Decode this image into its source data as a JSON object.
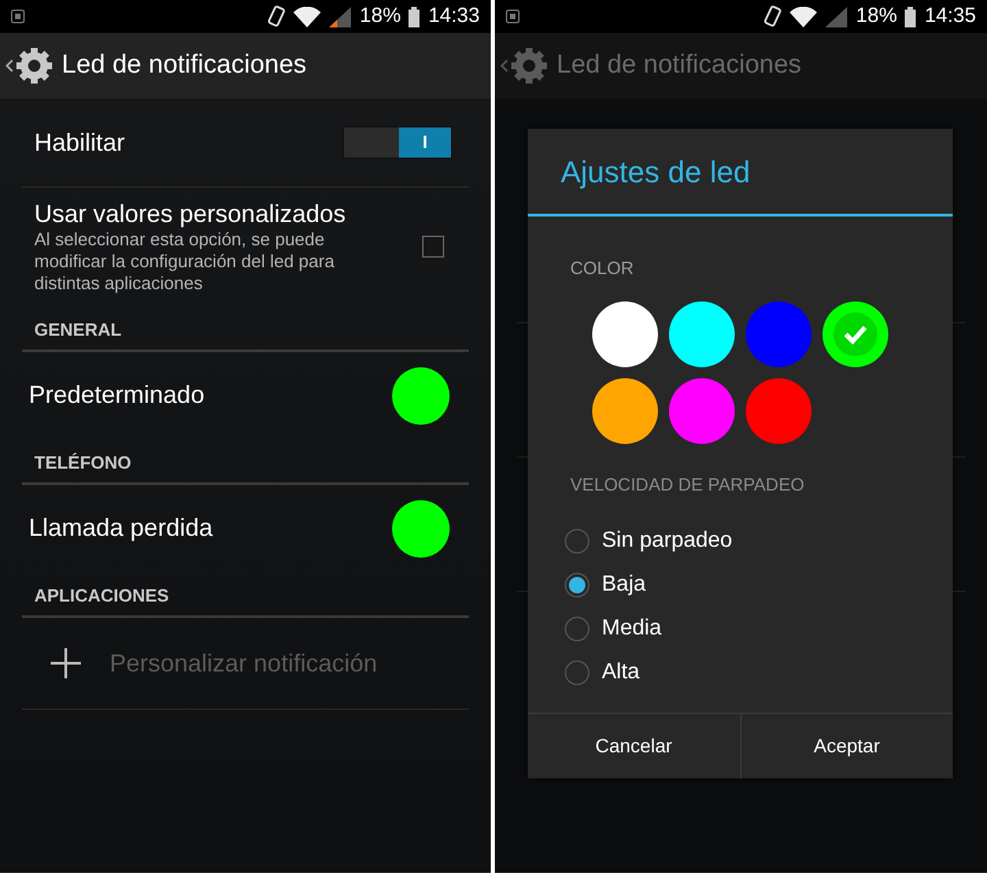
{
  "left_screen": {
    "status_bar": {
      "battery": "18%",
      "time": "14:33"
    },
    "action_bar": {
      "title": "Led de notificaciones"
    },
    "items": [
      {
        "kind": "switch",
        "label": "Habilitar",
        "on": true,
        "switch_text": "I"
      },
      {
        "kind": "checkbox",
        "label": "Usar valores personalizados",
        "summary": "Al seleccionar esta opción, se puede modificar la configuración del led para distintas aplicaciones",
        "checked": false
      },
      {
        "kind": "header",
        "label": "GENERAL"
      },
      {
        "kind": "color",
        "label": "Predeterminado",
        "color": "#00ff00"
      },
      {
        "kind": "header",
        "label": "TELÉFONO"
      },
      {
        "kind": "color",
        "label": "Llamada perdida",
        "color": "#00ff00"
      },
      {
        "kind": "header",
        "label": "APLICACIONES"
      },
      {
        "kind": "add",
        "label": "Personalizar notificación",
        "disabled": true
      }
    ]
  },
  "right_screen": {
    "status_bar": {
      "battery": "18%",
      "time": "14:35"
    },
    "action_bar": {
      "title": "Led de notificaciones"
    },
    "dialog": {
      "title": "Ajustes de led",
      "color_label": "COLOR",
      "swatches": [
        {
          "color": "#ffffff",
          "selected": false
        },
        {
          "color": "#00ffff",
          "selected": false
        },
        {
          "color": "#0000ff",
          "selected": false
        },
        {
          "color": "#00ff00",
          "selected": true
        },
        {
          "color": "#ffa500",
          "selected": false
        },
        {
          "color": "#ff00ff",
          "selected": false
        },
        {
          "color": "#ff0000",
          "selected": false
        }
      ],
      "speed_label": "VELOCIDAD DE PARPADEO",
      "options": [
        {
          "label": "Sin parpadeo",
          "selected": false
        },
        {
          "label": "Baja",
          "selected": true
        },
        {
          "label": "Media",
          "selected": false
        },
        {
          "label": "Alta",
          "selected": false
        }
      ],
      "buttons": [
        "Cancelar",
        "Aceptar"
      ]
    }
  }
}
